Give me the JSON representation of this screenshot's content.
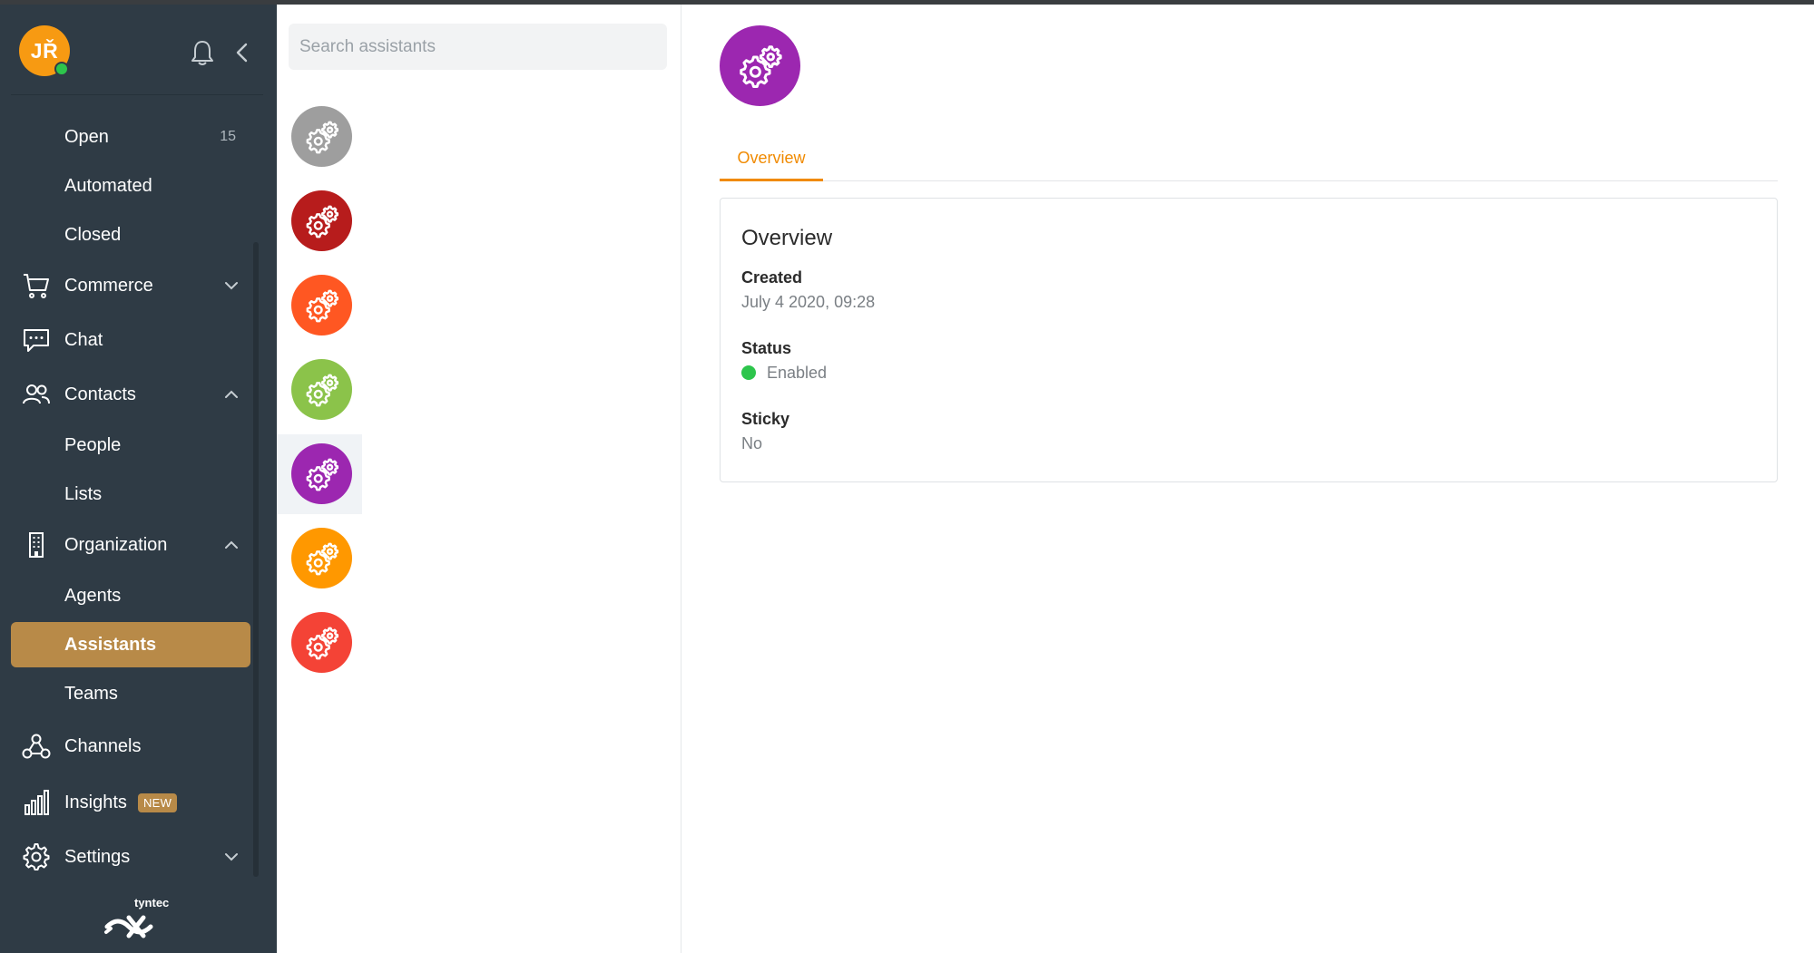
{
  "user": {
    "initials": "JŘ"
  },
  "sidebar": {
    "items": [
      {
        "label": "Open",
        "count": "15"
      },
      {
        "label": "Automated"
      },
      {
        "label": "Closed"
      },
      {
        "label": "Commerce"
      },
      {
        "label": "Chat"
      },
      {
        "label": "Contacts"
      },
      {
        "label": "People"
      },
      {
        "label": "Lists"
      },
      {
        "label": "Organization"
      },
      {
        "label": "Agents"
      },
      {
        "label": "Assistants"
      },
      {
        "label": "Teams"
      },
      {
        "label": "Channels"
      },
      {
        "label": "Insights",
        "badge": "NEW"
      },
      {
        "label": "Settings"
      }
    ],
    "brand": "tyntec"
  },
  "assistant_list": {
    "search_placeholder": "Search assistants",
    "avatar_colors": [
      "#9e9e9e",
      "#b71c1c",
      "#ff5722",
      "#8bc34a",
      "#9c27b0",
      "#ff9800",
      "#f44336"
    ],
    "selected_index": 4
  },
  "detail": {
    "avatar_color": "#9c27b0",
    "tab_overview": "Overview",
    "card_title": "Overview",
    "created_label": "Created",
    "created_value": "July 4 2020, 09:28",
    "status_label": "Status",
    "status_value": "Enabled",
    "status_color": "#2dc54c",
    "sticky_label": "Sticky",
    "sticky_value": "No"
  },
  "colors": {
    "sidebar_bg": "#2f3b45",
    "active_item": "#b88a48",
    "accent": "#f08a00"
  }
}
